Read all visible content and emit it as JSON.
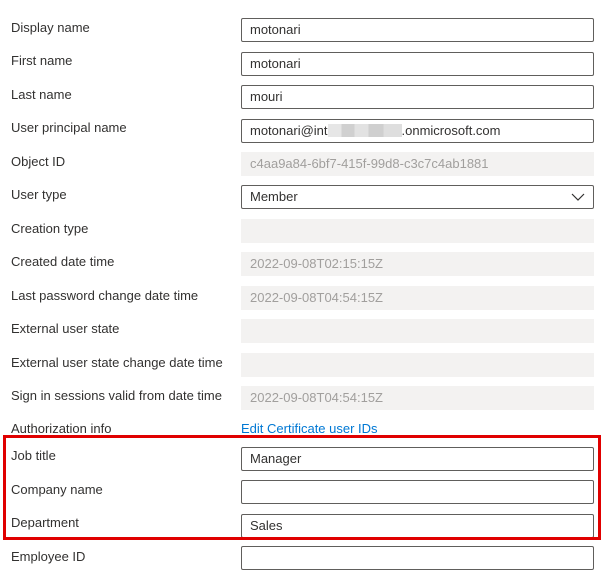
{
  "fields": {
    "display_name": {
      "label": "Display name",
      "value": "motonari"
    },
    "first_name": {
      "label": "First name",
      "value": "motonari"
    },
    "last_name": {
      "label": "Last name",
      "value": "mouri"
    },
    "upn": {
      "label": "User principal name",
      "value_prefix": "motonari@int",
      "value_suffix": ".onmicrosoft.com"
    },
    "object_id": {
      "label": "Object ID",
      "value": "c4aa9a84-6bf7-415f-99d8-c3c7c4ab1881"
    },
    "user_type": {
      "label": "User type",
      "value": "Member"
    },
    "creation_type": {
      "label": "Creation type",
      "value": ""
    },
    "created": {
      "label": "Created date time",
      "value": "2022-09-08T02:15:15Z"
    },
    "last_pwd": {
      "label": "Last password change date time",
      "value": "2022-09-08T04:54:15Z"
    },
    "ext_state": {
      "label": "External user state",
      "value": ""
    },
    "ext_state_change": {
      "label": "External user state change date time",
      "value": ""
    },
    "sign_in_valid": {
      "label": "Sign in sessions valid from date time",
      "value": "2022-09-08T04:54:15Z"
    },
    "auth_info": {
      "label": "Authorization info",
      "link": "Edit Certificate user IDs"
    },
    "job_title": {
      "label": "Job title",
      "value": "Manager"
    },
    "company": {
      "label": "Company name",
      "value": ""
    },
    "department": {
      "label": "Department",
      "value": "Sales"
    },
    "employee_id": {
      "label": "Employee ID",
      "value": ""
    }
  },
  "colors": {
    "highlight": "#e00000",
    "link": "#0078d4"
  },
  "icons": {
    "user_type_dropdown": "chevron-down-icon"
  }
}
